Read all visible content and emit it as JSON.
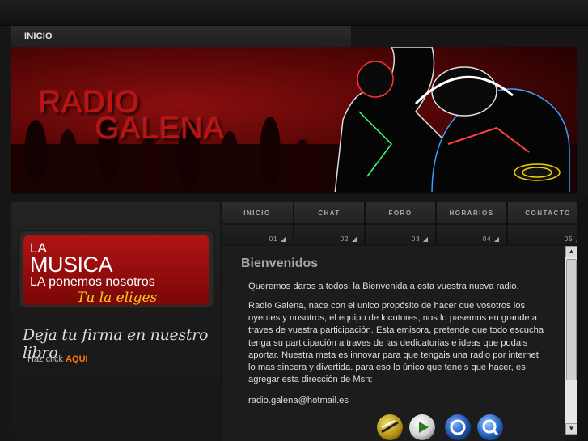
{
  "nav": {
    "inicio": "INICIO"
  },
  "banner": {
    "logo_line1": "RADIO",
    "logo_line2": "GALENA"
  },
  "sidebar": {
    "promo": {
      "la": "LA",
      "musica": "MUSICA",
      "ponemos": "LA ponemos nosotros",
      "eliges": "Tu la eliges"
    },
    "guestbook": "Deja tu firma en nuestro libro",
    "hazclick_prefix": "Haz click",
    "hazclick_link": "AQUI"
  },
  "tabs": [
    {
      "label": "INICIO",
      "num": "01 ◢"
    },
    {
      "label": "CHAT",
      "num": "02 ◢"
    },
    {
      "label": "FORO",
      "num": "03 ◢"
    },
    {
      "label": "HORARIOS",
      "num": "04 ◢"
    },
    {
      "label": "CONTACTO",
      "num": "05 ◢"
    }
  ],
  "content": {
    "title": "Bienvenidos",
    "p1": "Queremos daros a todos. la Bienvenida a esta vuestra nueva radio.",
    "p2": "Radio Galena, nace con el unico propósito de hacer que vosotros los oyentes y nosotros, el equipo de locutores, nos lo pasemos en grande a traves de vuestra participación. Esta emisora, pretende que todo escucha tenga su participación a traves de las dedicatorias e ideas que podais aportar. Nuestra meta es innovar para que tengais una radio por internet lo mas sincera y divertida. para eso lo único que teneis que hacer, es agregar esta dirección de Msn:",
    "p3": "radio.galena@hotmail.es"
  },
  "icons": [
    "winamp-icon",
    "media-player-icon",
    "real-player-icon",
    "quicktime-icon"
  ],
  "colors": {
    "accent": "#ff7c00",
    "brand_red": "#c21010",
    "promo_yellow": "#f2d020"
  }
}
